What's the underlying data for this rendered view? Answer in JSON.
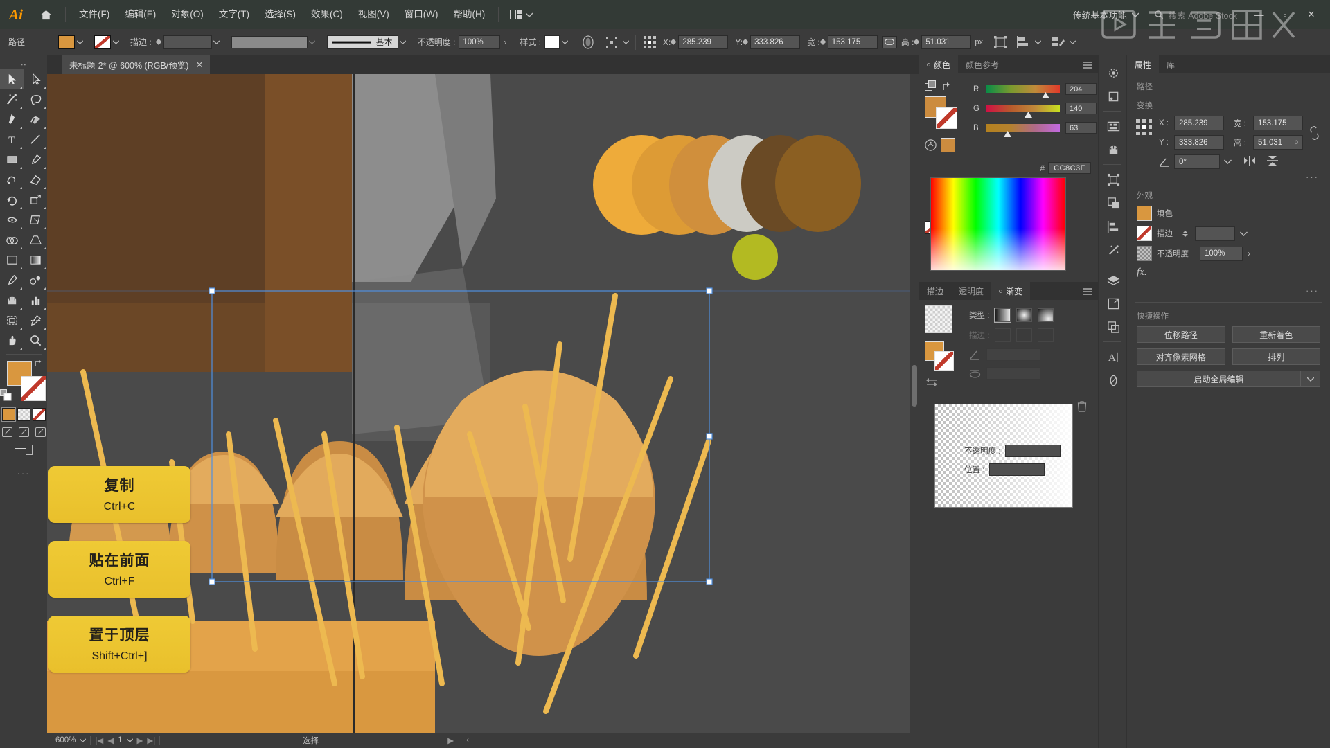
{
  "app": {
    "name": "Adobe Illustrator",
    "logo_text": "Ai"
  },
  "menubar": {
    "items": [
      {
        "label": "文件(F)"
      },
      {
        "label": "编辑(E)"
      },
      {
        "label": "对象(O)"
      },
      {
        "label": "文字(T)"
      },
      {
        "label": "选择(S)"
      },
      {
        "label": "效果(C)"
      },
      {
        "label": "视图(V)"
      },
      {
        "label": "窗口(W)"
      },
      {
        "label": "帮助(H)"
      }
    ],
    "workspace": "传统基本功能",
    "search_placeholder": "搜索 Adobe Stock",
    "win_min": "—",
    "win_max": "▫",
    "win_close": "✕"
  },
  "controlbar": {
    "context_label": "路径",
    "fill_color": "#D9973F",
    "stroke_label": "描边 :",
    "stroke_weight": "",
    "stroke_profile": "基本",
    "opacity_label": "不透明度 :",
    "opacity_value": "100%",
    "style_label": "样式 :",
    "x_label": "X:",
    "x_value": "285.239",
    "y_label": "Y:",
    "y_value": "333.826",
    "w_label": "宽 :",
    "w_value": "153.175",
    "h_label": "高 :",
    "h_value": "51.031",
    "unit": "px"
  },
  "toolbar": {
    "tools": [
      {
        "name": "selection-tool",
        "glyph": "sel",
        "active": true
      },
      {
        "name": "direct-selection-tool",
        "glyph": "dsel"
      },
      {
        "name": "magic-wand-tool",
        "glyph": "wand"
      },
      {
        "name": "lasso-tool",
        "glyph": "lasso"
      },
      {
        "name": "pen-tool",
        "glyph": "pen"
      },
      {
        "name": "curvature-tool",
        "glyph": "curv"
      },
      {
        "name": "type-tool",
        "glyph": "type"
      },
      {
        "name": "line-segment-tool",
        "glyph": "line"
      },
      {
        "name": "rectangle-tool",
        "glyph": "rect"
      },
      {
        "name": "paintbrush-tool",
        "glyph": "brush"
      },
      {
        "name": "shaper-tool",
        "glyph": "shaper"
      },
      {
        "name": "eraser-tool",
        "glyph": "eraser"
      },
      {
        "name": "rotate-tool",
        "glyph": "rotate"
      },
      {
        "name": "scale-tool",
        "glyph": "scale"
      },
      {
        "name": "width-tool",
        "glyph": "width"
      },
      {
        "name": "free-transform-tool",
        "glyph": "freexf"
      },
      {
        "name": "shape-builder-tool",
        "glyph": "shapebuild"
      },
      {
        "name": "perspective-grid-tool",
        "glyph": "persp"
      },
      {
        "name": "mesh-tool",
        "glyph": "mesh"
      },
      {
        "name": "gradient-tool",
        "glyph": "grad"
      },
      {
        "name": "eyedropper-tool",
        "glyph": "eyedrop"
      },
      {
        "name": "blend-tool",
        "glyph": "blend"
      },
      {
        "name": "symbol-sprayer-tool",
        "glyph": "symbol"
      },
      {
        "name": "column-graph-tool",
        "glyph": "graph"
      },
      {
        "name": "artboard-tool",
        "glyph": "artboard"
      },
      {
        "name": "slice-tool",
        "glyph": "slice"
      },
      {
        "name": "hand-tool",
        "glyph": "hand"
      },
      {
        "name": "zoom-tool",
        "glyph": "zoom"
      }
    ],
    "fill_color": "#D9973F",
    "stroke_color": "none",
    "screen_modes": [
      "normal",
      "full-menu",
      "full"
    ],
    "more_tools": "···"
  },
  "document": {
    "tab_title": "未标题-2* @ 600% (RGB/预览)",
    "close_glyph": "✕"
  },
  "statusbar": {
    "zoom": "600%",
    "artboard_number": "1",
    "tool_status": "选择"
  },
  "callouts": [
    {
      "title": "复制",
      "shortcut": "Ctrl+C"
    },
    {
      "title": "贴在前面",
      "shortcut": "Ctrl+F"
    },
    {
      "title": "置于顶层",
      "shortcut": "Shift+Ctrl+]"
    }
  ],
  "color_panel": {
    "tabs": [
      {
        "label": "颜色",
        "on": true
      },
      {
        "label": "颜色参考",
        "on": false
      }
    ],
    "channels": [
      {
        "label": "R",
        "value": "204",
        "pos": 0.8
      },
      {
        "label": "G",
        "value": "140",
        "pos": 0.55
      },
      {
        "label": "B",
        "value": "63",
        "pos": 0.25
      }
    ],
    "hex_prefix": "#",
    "hex": "CC8C3F",
    "current_color": "#CC8C3F"
  },
  "gradient_panel": {
    "tabs": [
      {
        "label": "描边",
        "on": false
      },
      {
        "label": "透明度",
        "on": false
      },
      {
        "label": "渐变",
        "on": true
      }
    ],
    "type_label": "类型 :",
    "stroke_label": "描边 :",
    "angle_label": "角度",
    "angle_value": "",
    "aspect_value": "",
    "opacity_label": "不透明度 :",
    "location_label": "位置 :",
    "opacity_value": "",
    "location_value": ""
  },
  "properties_panel": {
    "tabs": [
      {
        "label": "属性",
        "on": true
      },
      {
        "label": "库",
        "on": false
      }
    ],
    "section_path": "路径",
    "section_transform": "变换",
    "x_label": "X :",
    "x_value": "285.239",
    "y_label": "Y :",
    "y_value": "333.826",
    "w_label": "宽 :",
    "w_value": "153.175",
    "h_label": "高 :",
    "h_value": "51.031",
    "unit": "p",
    "angle_value": "0°",
    "section_appearance": "外观",
    "fill_label": "填色",
    "stroke_label": "描边",
    "stroke_weight": "",
    "opacity_label": "不透明度",
    "opacity_value": "100%",
    "fx_label": "fx.",
    "more_glyph": "···",
    "section_quick": "快捷操作",
    "quick_actions": [
      {
        "label": "位移路径"
      },
      {
        "label": "重新着色"
      },
      {
        "label": "对齐像素网格"
      },
      {
        "label": "排列"
      },
      {
        "label": "启动全局编辑"
      }
    ]
  },
  "artwork": {
    "bg": "#4a4a4a",
    "panel_dark_brown": "#5a3c23",
    "panel_mid_brown": "#6b4726",
    "panel_light_brown": "#8a5a2a",
    "gray_shape": "#8d8d8d",
    "gray_shape2": "#787878",
    "wheat_light": "#e0a85c",
    "wheat_mid": "#c98c44",
    "wheat_dark": "#b87a36",
    "stalk": "#edb950",
    "ground": "#e3a34a",
    "ground2": "#d99840",
    "circle_olive": "#b3ba22",
    "circles": [
      "#eeab3a",
      "#dd9b35",
      "#d08f3c",
      "#cccbc4",
      "#6a4a25",
      "#8b5f22"
    ],
    "selection_color": "#4f8fe0"
  }
}
